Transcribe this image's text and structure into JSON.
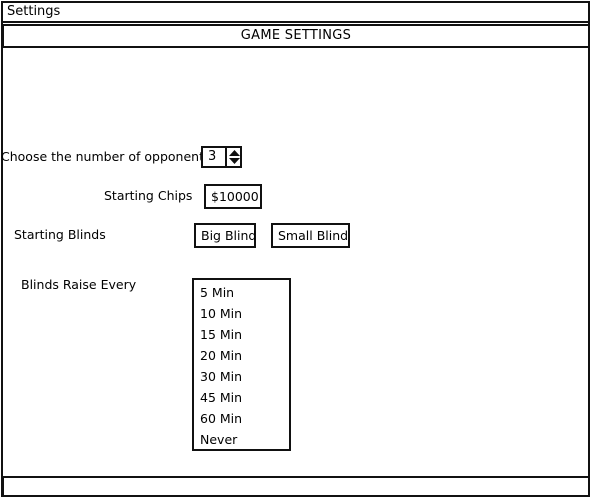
{
  "window": {
    "title": "Settings"
  },
  "header": {
    "title": "GAME SETTINGS"
  },
  "opponents": {
    "label": "Choose the number of opponents",
    "value": "3"
  },
  "chips": {
    "label": "Starting Chips",
    "value": "$10000"
  },
  "blinds": {
    "label": "Starting Blinds",
    "big_label": "Big Blind",
    "small_label": "Small Blind"
  },
  "raise": {
    "label": "Blinds Raise Every",
    "options": [
      "5 Min",
      "10 Min",
      "15 Min",
      "20 Min",
      "30 Min",
      "45 Min",
      "60 Min",
      "Never"
    ]
  }
}
